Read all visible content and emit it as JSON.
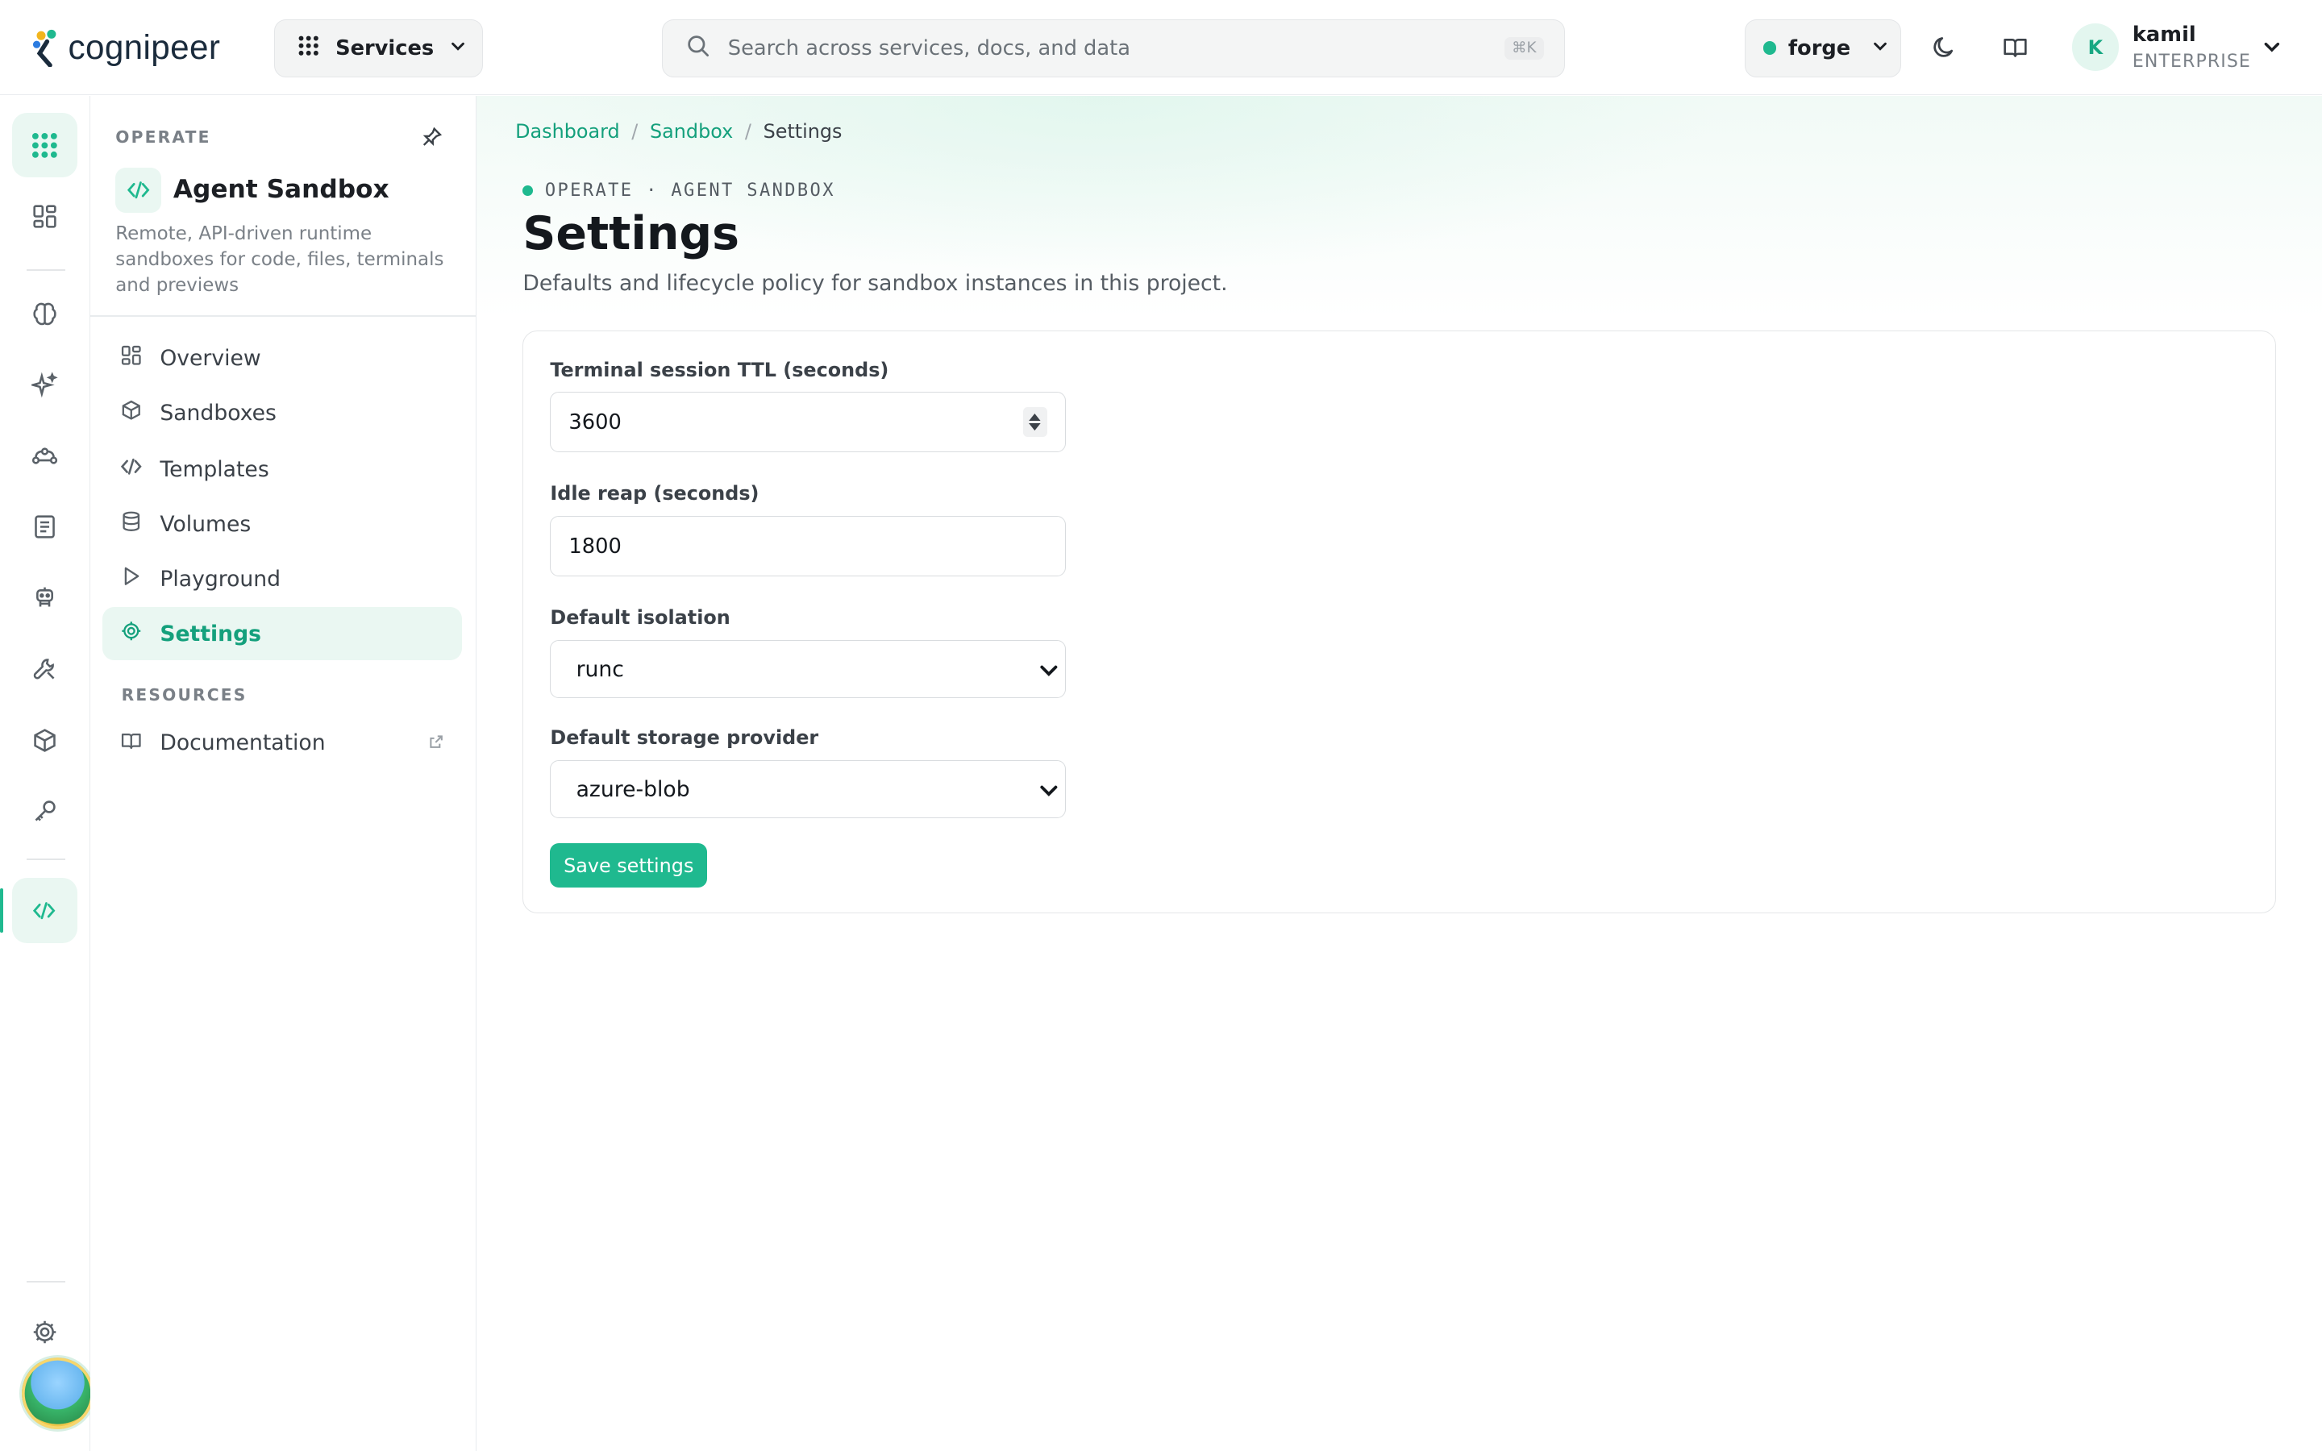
{
  "topbar": {
    "brand": "cognipeer",
    "services_label": "Services",
    "search_placeholder": "Search across services, docs, and data",
    "search_shortcut": "⌘K",
    "project": "forge",
    "user_initial": "K",
    "user_name": "kamil",
    "user_tier": "ENTERPRISE"
  },
  "section": {
    "label": "OPERATE",
    "title": "Agent Sandbox",
    "description": "Remote, API-driven runtime sandboxes for code, files, terminals and previews",
    "nav": [
      {
        "label": "Overview",
        "icon": "overview-icon"
      },
      {
        "label": "Sandboxes",
        "icon": "cube-icon"
      },
      {
        "label": "Templates",
        "icon": "code-icon"
      },
      {
        "label": "Volumes",
        "icon": "database-icon"
      },
      {
        "label": "Playground",
        "icon": "play-icon"
      },
      {
        "label": "Settings",
        "icon": "gear-icon",
        "active": true
      }
    ],
    "resources_label": "RESOURCES",
    "documentation_label": "Documentation"
  },
  "breadcrumb": {
    "items": [
      "Dashboard",
      "Sandbox"
    ],
    "current": "Settings"
  },
  "page": {
    "eyebrow": "OPERATE · AGENT SANDBOX",
    "title": "Settings",
    "subtitle": "Defaults and lifecycle policy for sandbox instances in this project."
  },
  "form": {
    "ttl_label": "Terminal session TTL (seconds)",
    "ttl_value": "3600",
    "idle_label": "Idle reap (seconds)",
    "idle_value": "1800",
    "isolation_label": "Default isolation",
    "isolation_value": "runc",
    "storage_label": "Default storage provider",
    "storage_value": "azure-blob",
    "save_label": "Save settings"
  },
  "colors": {
    "accent": "#1fb98f",
    "accent_text": "#14a07c",
    "active_bg": "#eaf7f2"
  }
}
